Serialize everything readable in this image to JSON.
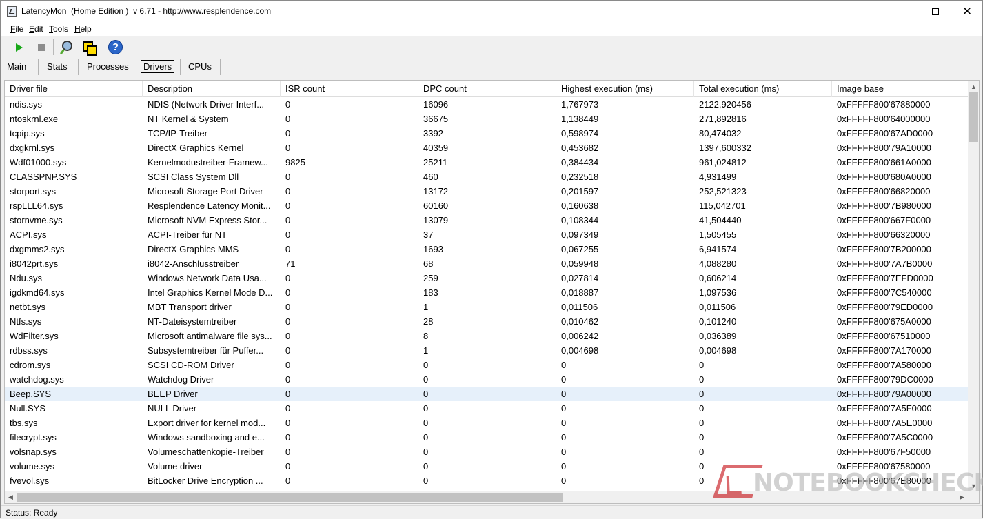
{
  "window": {
    "title": "LatencyMon  (Home Edition )  v 6.71 - http://www.resplendence.com",
    "minimize": "—",
    "maximize": "☐",
    "close": "✕"
  },
  "menu": [
    {
      "label": "File",
      "underline": "F"
    },
    {
      "label": "Edit",
      "underline": "E"
    },
    {
      "label": "Tools",
      "underline": "T"
    },
    {
      "label": "Help",
      "underline": "H"
    }
  ],
  "toolbar": {
    "start_icon": "play-icon",
    "stop_icon": "stop-icon",
    "monitor_icon": "magnify-icon",
    "windows_icon": "windows-icon",
    "help_icon": "help-icon",
    "help_label": "?"
  },
  "tabs": [
    "Main",
    "Stats",
    "Processes",
    "Drivers",
    "CPUs"
  ],
  "active_tab": "Drivers",
  "grid": {
    "columns": [
      "Driver file",
      "Description",
      "ISR count",
      "DPC count",
      "Highest execution (ms)",
      "Total execution (ms)",
      "Image base"
    ],
    "rows": [
      [
        "ndis.sys",
        "NDIS (Network Driver Interf...",
        "0",
        "16096",
        "1,767973",
        "2122,920456",
        "0xFFFFF800'67880000"
      ],
      [
        "ntoskrnl.exe",
        "NT Kernel & System",
        "0",
        "36675",
        "1,138449",
        "271,892816",
        "0xFFFFF800'64000000"
      ],
      [
        "tcpip.sys",
        "TCP/IP-Treiber",
        "0",
        "3392",
        "0,598974",
        "80,474032",
        "0xFFFFF800'67AD0000"
      ],
      [
        "dxgkrnl.sys",
        "DirectX Graphics Kernel",
        "0",
        "40359",
        "0,453682",
        "1397,600332",
        "0xFFFFF800'79A10000"
      ],
      [
        "Wdf01000.sys",
        "Kernelmodustreiber-Framew...",
        "9825",
        "25211",
        "0,384434",
        "961,024812",
        "0xFFFFF800'661A0000"
      ],
      [
        "CLASSPNP.SYS",
        "SCSI Class System Dll",
        "0",
        "460",
        "0,232518",
        "4,931499",
        "0xFFFFF800'680A0000"
      ],
      [
        "storport.sys",
        "Microsoft Storage Port Driver",
        "0",
        "13172",
        "0,201597",
        "252,521323",
        "0xFFFFF800'66820000"
      ],
      [
        "rspLLL64.sys",
        "Resplendence Latency Monit...",
        "0",
        "60160",
        "0,160638",
        "115,042701",
        "0xFFFFF800'7B980000"
      ],
      [
        "stornvme.sys",
        "Microsoft NVM Express Stor...",
        "0",
        "13079",
        "0,108344",
        "41,504440",
        "0xFFFFF800'667F0000"
      ],
      [
        "ACPI.sys",
        "ACPI-Treiber für NT",
        "0",
        "37",
        "0,097349",
        "1,505455",
        "0xFFFFF800'66320000"
      ],
      [
        "dxgmms2.sys",
        "DirectX Graphics MMS",
        "0",
        "1693",
        "0,067255",
        "6,941574",
        "0xFFFFF800'7B200000"
      ],
      [
        "i8042prt.sys",
        "i8042-Anschlusstreiber",
        "71",
        "68",
        "0,059948",
        "4,088280",
        "0xFFFFF800'7A7B0000"
      ],
      [
        "Ndu.sys",
        "Windows Network Data Usa...",
        "0",
        "259",
        "0,027814",
        "0,606214",
        "0xFFFFF800'7EFD0000"
      ],
      [
        "igdkmd64.sys",
        "Intel Graphics Kernel Mode D...",
        "0",
        "183",
        "0,018887",
        "1,097536",
        "0xFFFFF800'7C540000"
      ],
      [
        "netbt.sys",
        "MBT Transport driver",
        "0",
        "1",
        "0,011506",
        "0,011506",
        "0xFFFFF800'79ED0000"
      ],
      [
        "Ntfs.sys",
        "NT-Dateisystemtreiber",
        "0",
        "28",
        "0,010462",
        "0,101240",
        "0xFFFFF800'675A0000"
      ],
      [
        "WdFilter.sys",
        "Microsoft antimalware file sys...",
        "0",
        "8",
        "0,006242",
        "0,036389",
        "0xFFFFF800'67510000"
      ],
      [
        "rdbss.sys",
        "Subsystemtreiber für Puffer...",
        "0",
        "1",
        "0,004698",
        "0,004698",
        "0xFFFFF800'7A170000"
      ],
      [
        "cdrom.sys",
        "SCSI CD-ROM Driver",
        "0",
        "0",
        "0",
        "0",
        "0xFFFFF800'7A580000"
      ],
      [
        "watchdog.sys",
        "Watchdog Driver",
        "0",
        "0",
        "0",
        "0",
        "0xFFFFF800'79DC0000"
      ],
      [
        "Beep.SYS",
        "BEEP Driver",
        "0",
        "0",
        "0",
        "0",
        "0xFFFFF800'79A00000"
      ],
      [
        "Null.SYS",
        "NULL Driver",
        "0",
        "0",
        "0",
        "0",
        "0xFFFFF800'7A5F0000"
      ],
      [
        "tbs.sys",
        "Export driver for kernel mod...",
        "0",
        "0",
        "0",
        "0",
        "0xFFFFF800'7A5E0000"
      ],
      [
        "filecrypt.sys",
        "Windows sandboxing and e...",
        "0",
        "0",
        "0",
        "0",
        "0xFFFFF800'7A5C0000"
      ],
      [
        "volsnap.sys",
        "Volumeschattenkopie-Treiber",
        "0",
        "0",
        "0",
        "0",
        "0xFFFFF800'67F50000"
      ],
      [
        "volume.sys",
        "Volume driver",
        "0",
        "0",
        "0",
        "0",
        "0xFFFFF800'67580000"
      ],
      [
        "fvevol.sys",
        "BitLocker Drive Encryption ...",
        "0",
        "0",
        "0",
        "0",
        "0xFFFFF800'67E80000"
      ]
    ],
    "selected_row": 20
  },
  "scroll": {
    "up_icon": "arrow-up-icon",
    "down_icon": "arrow-down-icon",
    "left_icon": "arrow-left-icon",
    "right_icon": "arrow-right-icon"
  },
  "status": "Status: Ready",
  "watermark": "NOTEBOOKCHECK",
  "colors": {
    "selected_row": "#e6f0fa",
    "play": "#18a818",
    "watermark_red": "#c61218"
  }
}
